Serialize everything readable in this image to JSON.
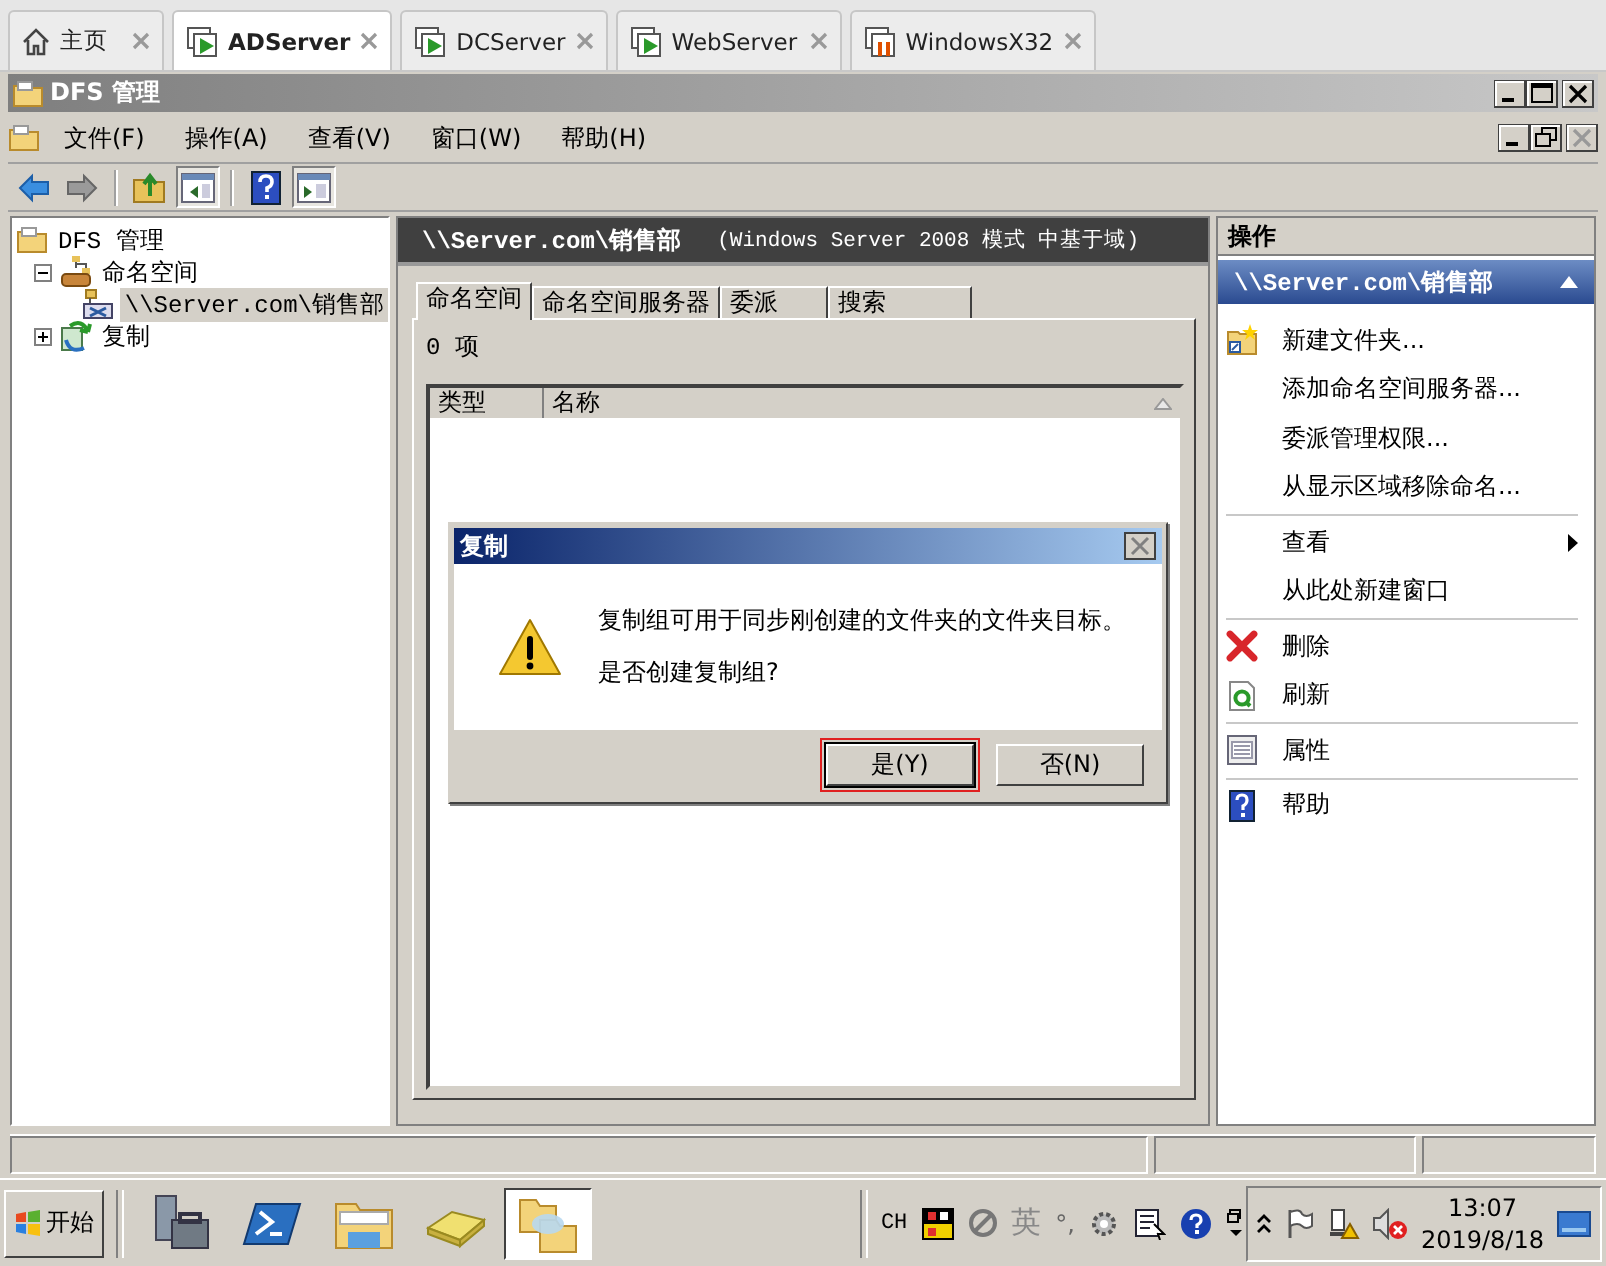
{
  "browser_tabs": [
    {
      "label": "主页",
      "kind": "home",
      "selected": false
    },
    {
      "label": "ADServer",
      "kind": "vm",
      "selected": true
    },
    {
      "label": "DCServer",
      "kind": "vm",
      "selected": false
    },
    {
      "label": "WebServer",
      "kind": "vm",
      "selected": false
    },
    {
      "label": "WindowsX32",
      "kind": "paused",
      "selected": false
    }
  ],
  "window": {
    "title": "DFS 管理"
  },
  "menu": [
    "文件(F)",
    "操作(A)",
    "查看(V)",
    "窗口(W)",
    "帮助(H)"
  ],
  "toolbar": [
    {
      "kind": "back",
      "pressed": false
    },
    {
      "kind": "forward",
      "pressed": false
    },
    {
      "kind": "up",
      "pressed": false
    },
    {
      "kind": "tree",
      "pressed": true
    },
    {
      "kind": "help",
      "pressed": false
    },
    {
      "kind": "actions",
      "pressed": true
    }
  ],
  "tree": [
    {
      "label": "DFS 管理",
      "kind": "dfs",
      "selected": false,
      "children": [
        {
          "label": "命名空间",
          "kind": "namespaces",
          "expanded": true,
          "selected": false,
          "children": [
            {
              "label": "\\\\Server.com\\销售部",
              "kind": "namespace",
              "selected": true
            }
          ]
        },
        {
          "label": "复制",
          "kind": "replication",
          "expanded": false,
          "selected": false
        }
      ]
    }
  ],
  "center": {
    "title": "\\\\Server.com\\销售部",
    "subtitle": "(Windows Server 2008 模式 中基于域)",
    "tabs": [
      {
        "label": "命名空间",
        "selected": true
      },
      {
        "label": "命名空间服务器",
        "selected": false
      },
      {
        "label": "委派",
        "selected": false
      },
      {
        "label": "搜索",
        "selected": false
      }
    ],
    "count": "0 项",
    "columns": [
      "类型",
      "名称"
    ]
  },
  "actions": {
    "title": "操作",
    "group": "\\\\Server.com\\销售部",
    "sections": [
      [
        {
          "label": "新建文件夹...",
          "kind": "new-folder"
        },
        {
          "label": "添加命名空间服务器...",
          "kind": "plain"
        },
        {
          "label": "委派管理权限...",
          "kind": "plain"
        },
        {
          "label": "从显示区域移除命名...",
          "kind": "plain"
        }
      ],
      [
        {
          "label": "查看",
          "kind": "submenu"
        },
        {
          "label": "从此处新建窗口",
          "kind": "plain"
        }
      ],
      [
        {
          "label": "删除",
          "kind": "delete"
        },
        {
          "label": "刷新",
          "kind": "refresh"
        }
      ],
      [
        {
          "label": "属性",
          "kind": "properties"
        }
      ],
      [
        {
          "label": "帮助",
          "kind": "help"
        }
      ]
    ]
  },
  "dialog": {
    "title": "复制",
    "lines": [
      "复制组可用于同步刚创建的文件夹的文件夹目标。",
      "是否创建复制组?"
    ],
    "buttons": [
      {
        "label": "是(Y)",
        "focused": true
      },
      {
        "label": "否(N)",
        "focused": false
      }
    ]
  },
  "taskbar": {
    "start": "开始",
    "apps": [
      {
        "kind": "server",
        "selected": false
      },
      {
        "kind": "powershell",
        "selected": false
      },
      {
        "kind": "explorer",
        "selected": false
      },
      {
        "kind": "drive",
        "selected": false
      },
      {
        "kind": "dfs",
        "selected": true
      }
    ],
    "lang": "CH",
    "ime": "英",
    "punct": "°,",
    "time": "13:07",
    "date": "2019/8/18"
  }
}
